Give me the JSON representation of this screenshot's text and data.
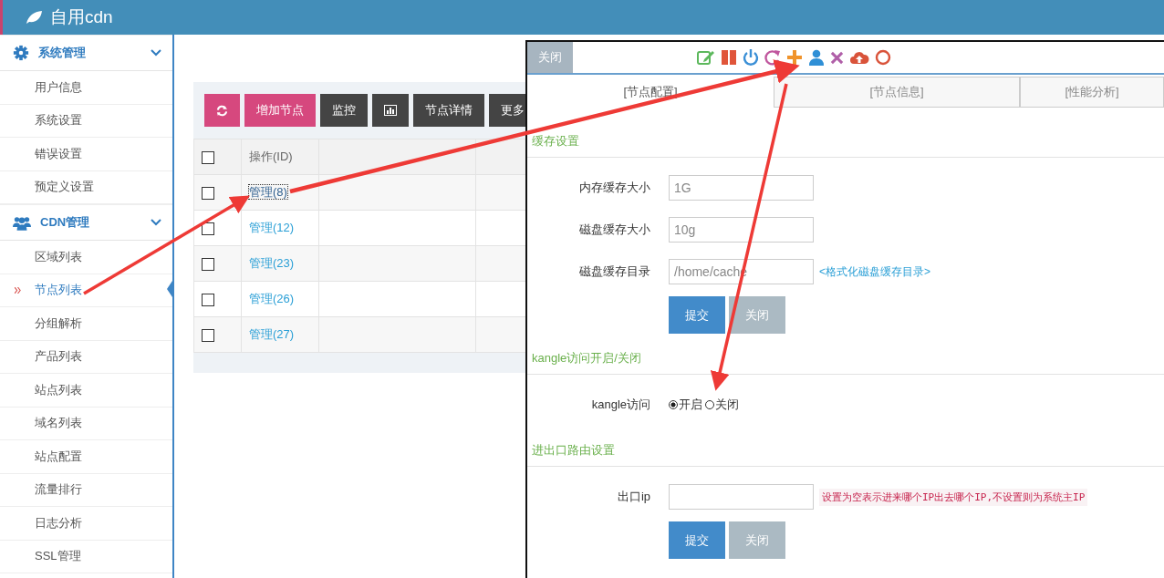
{
  "header": {
    "title": "自用cdn"
  },
  "sidebar": {
    "groups": [
      {
        "title": "系统管理",
        "kind": "gear",
        "expanded": true,
        "items": [
          {
            "label": "用户信息",
            "selected": false
          },
          {
            "label": "系统设置",
            "selected": false
          },
          {
            "label": "错误设置",
            "selected": false
          },
          {
            "label": "预定义设置",
            "selected": false
          }
        ]
      },
      {
        "title": "CDN管理",
        "kind": "users",
        "expanded": true,
        "items": [
          {
            "label": "区域列表",
            "selected": false
          },
          {
            "label": "节点列表",
            "selected": true
          },
          {
            "label": "分组解析",
            "selected": false
          },
          {
            "label": "产品列表",
            "selected": false
          },
          {
            "label": "站点列表",
            "selected": false
          },
          {
            "label": "域名列表",
            "selected": false
          },
          {
            "label": "站点配置",
            "selected": false
          },
          {
            "label": "流量排行",
            "selected": false
          },
          {
            "label": "日志分析",
            "selected": false
          },
          {
            "label": "SSL管理",
            "selected": false
          }
        ]
      }
    ]
  },
  "toolbar": [
    {
      "kind": "refresh",
      "color": "#d6487e"
    },
    {
      "kind": "text",
      "label": "增加节点",
      "color": "#d6487e"
    },
    {
      "kind": "text",
      "label": "监控",
      "color": "#444444"
    },
    {
      "kind": "chart",
      "color": "#444444"
    },
    {
      "kind": "text",
      "label": "节点详情",
      "color": "#444444"
    },
    {
      "kind": "text",
      "label": "更多",
      "color": "#444444"
    }
  ],
  "table": {
    "header_checked": false,
    "columns": [
      "操作(ID)"
    ],
    "rows": [
      {
        "checked": false,
        "link": "管理(8)",
        "focused": true
      },
      {
        "checked": false,
        "link": "管理(12)",
        "focused": false
      },
      {
        "checked": false,
        "link": "管理(23)",
        "focused": false
      },
      {
        "checked": false,
        "link": "管理(26)",
        "focused": false
      },
      {
        "checked": false,
        "link": "管理(27)",
        "focused": false
      }
    ]
  },
  "dialog": {
    "close_button": "关闭",
    "tabs": [
      {
        "label": "[节点配置]",
        "selected": true
      },
      {
        "label": "[节点信息]",
        "selected": false
      },
      {
        "label": "[性能分析]",
        "selected": false
      }
    ],
    "sections": [
      {
        "title": "缓存设置",
        "fields": [
          {
            "kind": "input",
            "label": "内存缓存大小",
            "value": "1G"
          },
          {
            "kind": "input",
            "label": "磁盘缓存大小",
            "value": "10g"
          },
          {
            "kind": "input",
            "label": "磁盘缓存目录",
            "value": "/home/cache",
            "link": "<格式化磁盘缓存目录>"
          }
        ],
        "buttons": [
          "提交",
          "关闭"
        ]
      },
      {
        "title": "kangle访问开启/关闭",
        "fields": [
          {
            "kind": "radio",
            "label": "kangle访问",
            "options": [
              {
                "label": "开启",
                "selected": true
              },
              {
                "label": "关闭",
                "selected": false
              }
            ]
          }
        ]
      },
      {
        "title": "进出口路由设置",
        "fields": [
          {
            "kind": "input",
            "label": "出口ip",
            "note": "设置为空表示进来哪个IP出去哪个IP,不设置则为系统主IP"
          }
        ],
        "buttons": [
          "提交",
          "关闭"
        ]
      }
    ]
  }
}
